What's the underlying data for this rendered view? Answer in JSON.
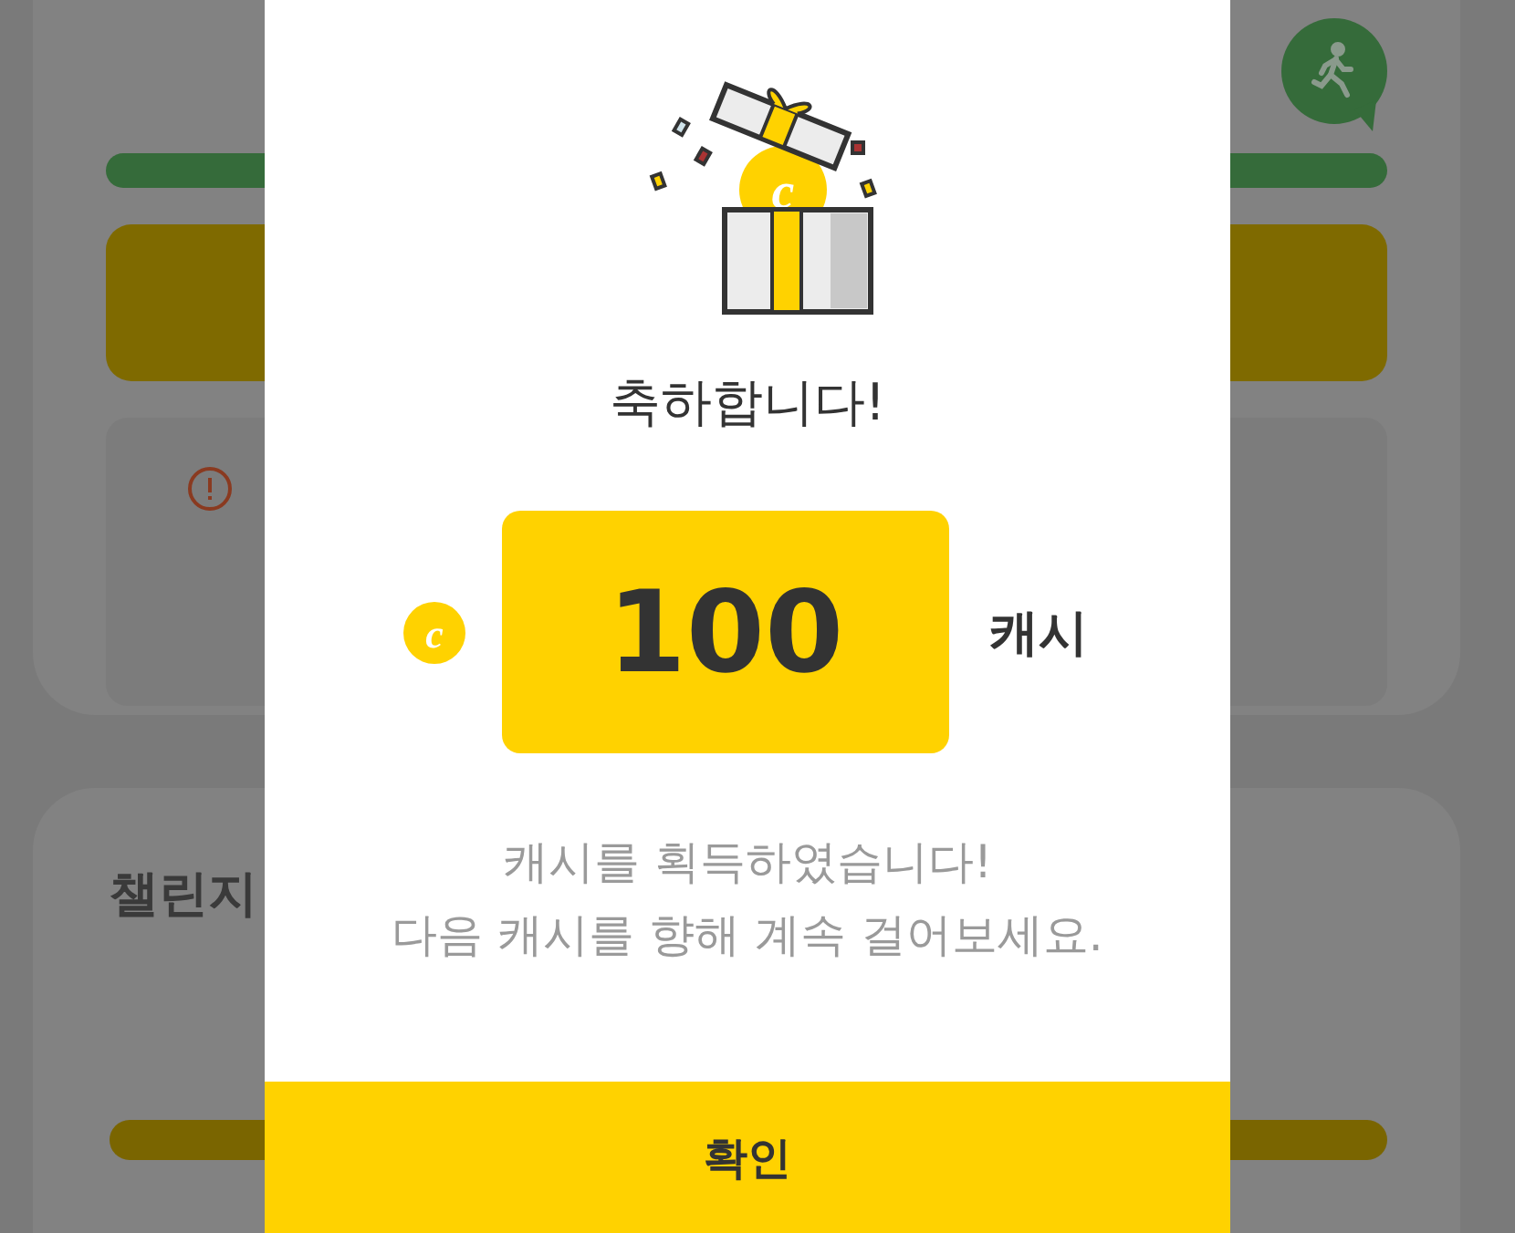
{
  "background": {
    "challenge_title": "챌린지"
  },
  "dialog": {
    "title": "축하합니다!",
    "gift_coin_symbol": "c",
    "coin_symbol": "c",
    "amount": "100",
    "unit": "캐시",
    "message": "캐시를 획득하였습니다!\n다음 캐시를 향해 계속 걸어보세요.",
    "confirm_button": "확인"
  }
}
